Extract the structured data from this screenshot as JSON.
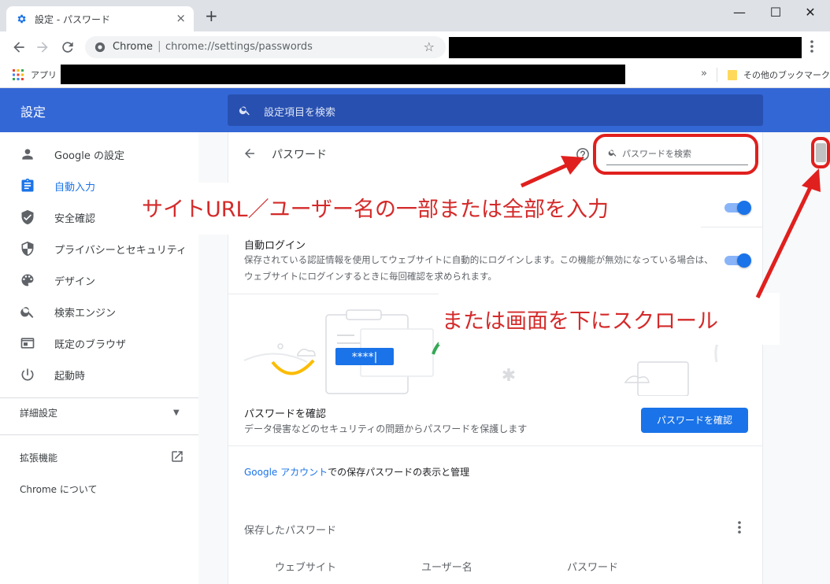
{
  "browser": {
    "tab_title": "設定 - パスワード",
    "tab_close": "×",
    "new_tab": "+",
    "win_min": "—",
    "win_max": "☐",
    "win_close": "✕",
    "omnibox_scheme": "Chrome",
    "omnibox_sep": "|",
    "omnibox_url": "chrome://settings/passwords",
    "star": "☆",
    "apps_label": "アプリ",
    "bookmarks_more": "»",
    "other_bookmarks": "その他のブックマーク"
  },
  "header": {
    "title": "設定",
    "search_placeholder": "設定項目を検索"
  },
  "sidebar": {
    "items": [
      {
        "label": "Google の設定",
        "icon": "person-icon"
      },
      {
        "label": "自動入力",
        "icon": "clipboard-icon"
      },
      {
        "label": "安全確認",
        "icon": "shield-check-icon"
      },
      {
        "label": "プライバシーとセキュリティ",
        "icon": "shield-half-icon"
      },
      {
        "label": "デザイン",
        "icon": "palette-icon"
      },
      {
        "label": "検索エンジン",
        "icon": "search-icon"
      },
      {
        "label": "既定のブラウザ",
        "icon": "browser-window-icon"
      },
      {
        "label": "起動時",
        "icon": "power-icon"
      }
    ],
    "advanced": "詳細設定",
    "advanced_caret": "▼",
    "extensions": "拡張機能",
    "about": "Chrome について"
  },
  "main": {
    "title": "パスワード",
    "search_placeholder": "パスワードを検索",
    "autologin_title": "自動ログイン",
    "autologin_desc": "保存されている認証情報を使用してウェブサイトに自動的にログインします。この機能が無効になっている場合は、ウェブサイトにログインするときに毎回確認を求められます。",
    "illustration_text": "****|",
    "check_title": "パスワードを確認",
    "check_desc": "データ侵害などのセキュリティの問題からパスワードを保護します",
    "check_button": "パスワードを確認",
    "google_account_link": "Google アカウント",
    "google_account_rest": "での保存パスワードの表示と管理",
    "saved_title": "保存したパスワード",
    "columns": [
      "ウェブサイト",
      "ユーザー名",
      "パスワード"
    ]
  },
  "annotations": {
    "search_hint": "サイトURL／ユーザー名の一部または全部を入力",
    "scroll_hint": "または画面を下にスクロール"
  },
  "colors": {
    "header_blue": "#3367d6",
    "accent_blue": "#1a73e8",
    "annotation_red": "#d42a2a"
  }
}
